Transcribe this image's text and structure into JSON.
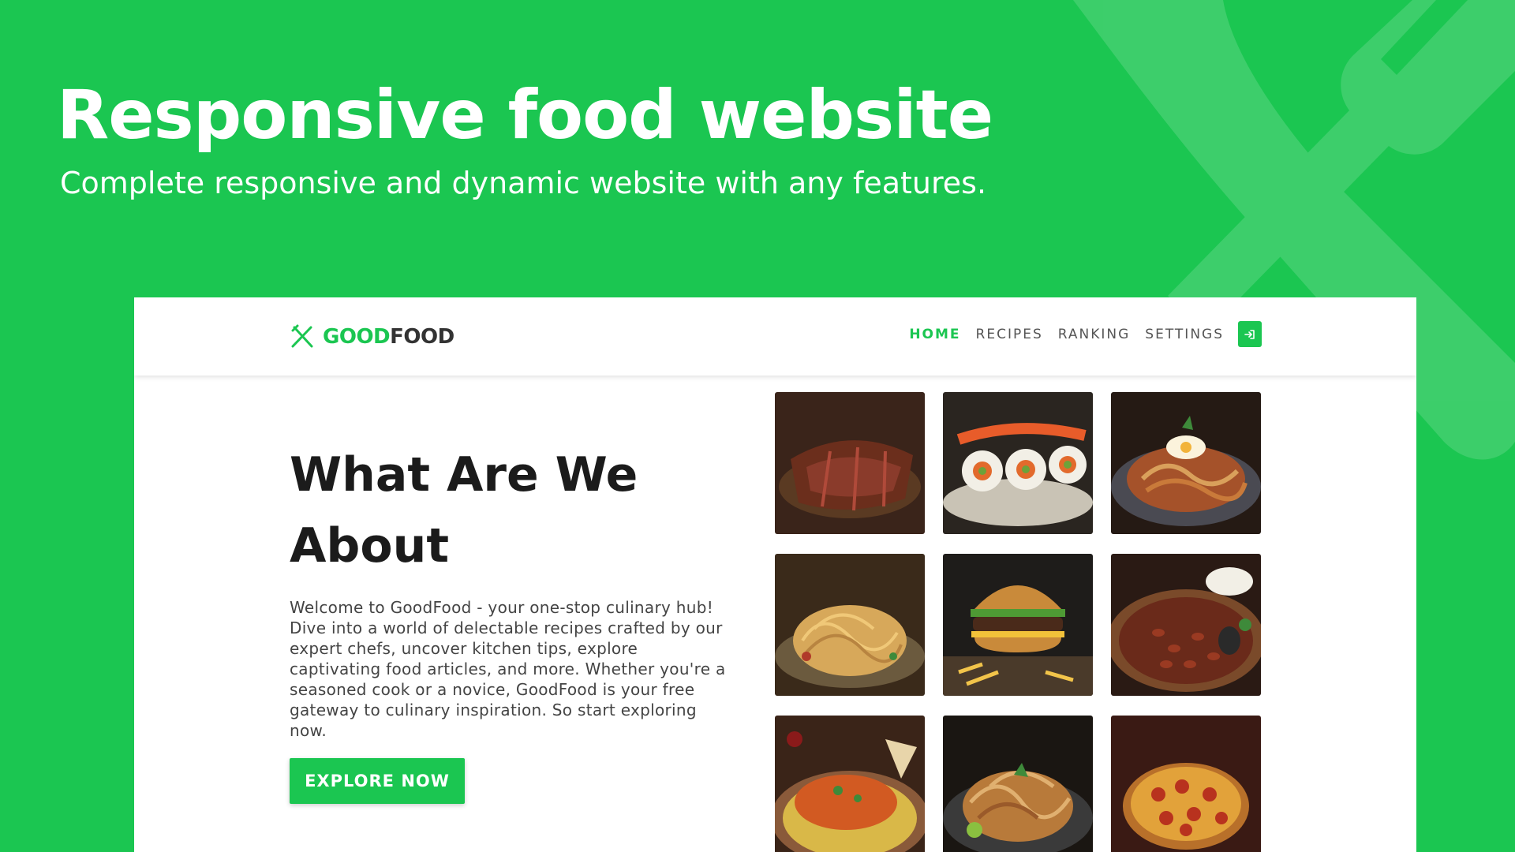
{
  "banner": {
    "title": "Responsive food website",
    "subtitle": "Complete responsive and dynamic website with any features."
  },
  "site": {
    "logo": {
      "good": "GOOD",
      "food": "FOOD",
      "icon": "fork-knife-icon"
    },
    "nav": {
      "items": [
        {
          "label": "HOME",
          "active": true
        },
        {
          "label": "RECIPES",
          "active": false
        },
        {
          "label": "RANKING",
          "active": false
        },
        {
          "label": "SETTINGS",
          "active": false
        }
      ],
      "login_icon": "login-icon"
    },
    "about": {
      "title": "What Are We About",
      "text": "Welcome to GoodFood - your one-stop culinary hub! Dive into a world of delectable recipes crafted by our expert chefs, uncover kitchen tips, explore captivating food articles, and more. Whether you're a seasoned cook or a novice, GoodFood is your free gateway to culinary inspiration. So start exploring now.",
      "button": "EXPLORE NOW"
    },
    "gallery": [
      "steak-image",
      "sushi-image",
      "stir-fry-image",
      "spaghetti-image",
      "burger-image",
      "beans-image",
      "curry-image",
      "noodles-image",
      "pizza-image"
    ]
  },
  "colors": {
    "brand": "#1bc651",
    "text_dark": "#1b1b1b",
    "text_body": "#444444"
  }
}
